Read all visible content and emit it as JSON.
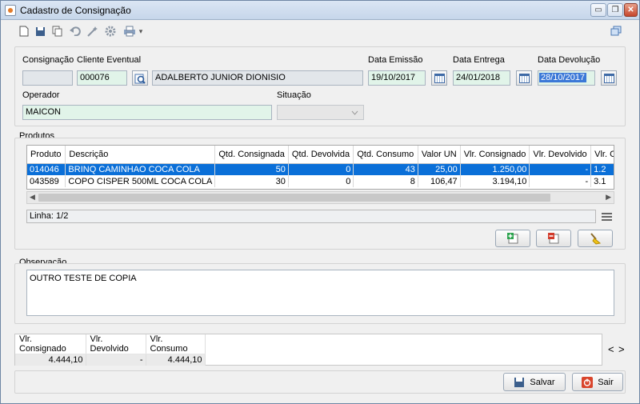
{
  "window": {
    "title": "Cadastro de Consignação",
    "minimize": "▭",
    "restore": "❐",
    "close": "✕"
  },
  "toolbar": {
    "icons": [
      "new-file-icon",
      "save-icon",
      "copy-icon",
      "undo-icon",
      "wand-icon",
      "gear-icon",
      "print-icon"
    ],
    "dropdown": "▾"
  },
  "form": {
    "consignacao": {
      "label": "Consignação",
      "value": ""
    },
    "cliente": {
      "label": "Cliente Eventual",
      "code": "000076",
      "name": "ADALBERTO JUNIOR DIONISIO"
    },
    "data_emissao": {
      "label": "Data Emissão",
      "value": "19/10/2017"
    },
    "data_entrega": {
      "label": "Data Entrega",
      "value": "24/01/2018"
    },
    "data_devolucao": {
      "label": "Data Devolução",
      "value": "28/10/2017"
    },
    "operador": {
      "label": "Operador",
      "value": "MAICON"
    },
    "situacao": {
      "label": "Situação",
      "value": ""
    }
  },
  "produtos": {
    "title": "Produtos",
    "columns": [
      "Produto",
      "Descrição",
      "Qtd. Consignada",
      "Qtd. Devolvida",
      "Qtd. Consumo",
      "Valor UN",
      "Vlr. Consignado",
      "Vlr. Devolvido",
      "Vlr. Con"
    ],
    "rows": [
      [
        "014046",
        "BRINQ CAMINHAO COCA COLA",
        "50",
        "0",
        "43",
        "25,00",
        "1.250,00",
        "-",
        "1.2"
      ],
      [
        "043589",
        "COPO CISPER 500ML COCA COLA",
        "30",
        "0",
        "8",
        "106,47",
        "3.194,10",
        "-",
        "3.1"
      ]
    ],
    "linha": "Linha: 1/2"
  },
  "observacao": {
    "title": "Observação",
    "text": "OUTRO TESTE DE COPIA"
  },
  "totals": {
    "headers": [
      "Vlr. Consignado",
      "Vlr. Devolvido",
      "Vlr. Consumo"
    ],
    "values": [
      "4.444,10",
      "-",
      "4.444,10"
    ]
  },
  "nav": {
    "prev": "<",
    "next": ">"
  },
  "buttons": {
    "salvar": "Salvar",
    "sair": "Sair"
  }
}
